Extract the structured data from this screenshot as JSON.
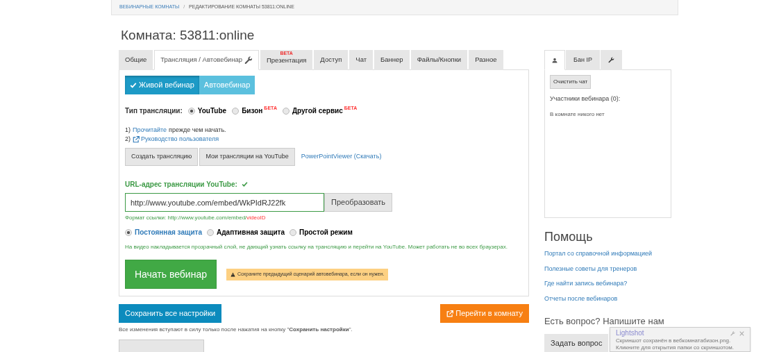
{
  "breadcrumb_separator": "/",
  "breadcrumbs": [
    {
      "label": "ВЕБИНАРНЫЕ КОМНАТЫ",
      "kind": "link"
    },
    {
      "label": "РЕДАКТИРОВАНИЕ КОМНАТЫ 53811:ONLINE",
      "kind": "current"
    }
  ],
  "title": "Комната: 53811:online",
  "tabs": [
    {
      "label": "Общие",
      "selected": false,
      "kind": "text"
    },
    {
      "label": "Трансляция / Автовебинар",
      "selected": true,
      "kind": "wrench"
    },
    {
      "label": "Презентация",
      "selected": false,
      "kind": "text",
      "badge": "BETA"
    },
    {
      "label": "Доступ",
      "selected": false,
      "kind": "text"
    },
    {
      "label": "Чат",
      "selected": false,
      "kind": "text"
    },
    {
      "label": "Баннер",
      "selected": false,
      "kind": "text"
    },
    {
      "label": "Файлы/Кнопки",
      "selected": false,
      "kind": "text"
    },
    {
      "label": "Разное",
      "selected": false,
      "kind": "text"
    }
  ],
  "mode_toggle": [
    {
      "label": "Живой вебинар",
      "selected": true
    },
    {
      "label": "Автовебинар",
      "selected": false
    }
  ],
  "stream_type": {
    "label": "Тип трансляции:",
    "options": [
      {
        "label": "YouTube",
        "selected": true
      },
      {
        "label": "Бизон",
        "selected": false,
        "badge": "БЕТА"
      },
      {
        "label": "Другой сервис",
        "selected": false,
        "badge": "БЕТА"
      }
    ]
  },
  "steps": [
    {
      "prefix": "1)",
      "link": "Прочитайте",
      "suffix": "прежде чем начать.",
      "kind": "plain"
    },
    {
      "prefix": "2)",
      "link": "Руководство пользователя",
      "kind": "external"
    }
  ],
  "actions": {
    "buttons": [
      "Создать трансляцию",
      "Мои трансляции на YouTube"
    ],
    "link": "PowerPointViewer (Скачать)"
  },
  "url": {
    "label": "URL-адрес трансляции YouTube:",
    "valid": true,
    "value": "http://www.youtube.com/embed/WkPIdRJ22fk",
    "button": "Преобразовать",
    "hint": "Формат ссылки: http://www.youtube.com/embed/",
    "hint_id": "videoID"
  },
  "protection": {
    "options": [
      {
        "label": "Постоянная защита",
        "selected": true
      },
      {
        "label": "Адаптивная защита",
        "selected": false
      },
      {
        "label": "Простой режим",
        "selected": false
      }
    ],
    "description": "На видео накладывается прозрачный слой, не дающий узнать ссылку на трансляцию и перейти на YouTube. Может работать не во всех браузерах."
  },
  "start_button": "Начать вебинар",
  "warning": "Сохраните предыдущий сценарий автовебинара, если он нужен.",
  "save_button": "Сохранить все настройки",
  "go_button": "Перейти в комнату",
  "note": "Все изменения вступают в силу только после нажатия на кнопку \"**Сохранить настройки**\".",
  "side_tabs": [
    {
      "kind": "user",
      "selected": true
    },
    {
      "kind": "text",
      "label": "Бан IP",
      "selected": false
    },
    {
      "kind": "wrench",
      "selected": false
    }
  ],
  "chat": {
    "clear_button": "Очистить чат",
    "participants": "Участники вебинара (0):",
    "empty": "В комнате никого нет"
  },
  "help": {
    "title": "Помощь",
    "links": [
      "Портал со справочной информацией",
      "Полезные советы для тренеров",
      "Где найти запись вебинара?",
      "Отчеты после вебинаров"
    ]
  },
  "question": {
    "title": "Есть вопрос? Напишите нам",
    "button": "Задать вопрос"
  },
  "notification": {
    "title": "Lightshot",
    "lines": [
      "Скриншот сохранён в вебкомнатабизон.png.",
      "Кликните для открытия папки со скриншотом."
    ]
  }
}
